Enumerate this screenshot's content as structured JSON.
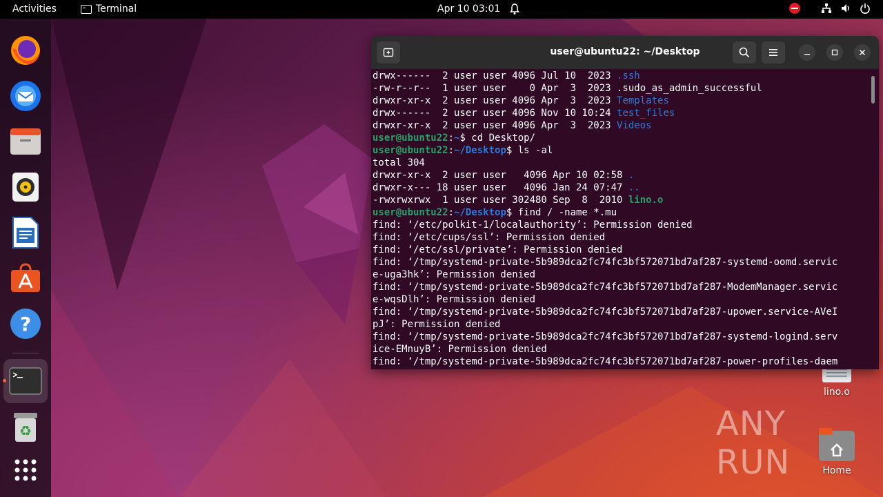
{
  "topbar": {
    "activities": "Activities",
    "app_name": "Terminal",
    "clock": "Apr 10  03:01"
  },
  "dock": {
    "items": [
      {
        "name": "firefox",
        "icon": "firefox-icon"
      },
      {
        "name": "thunderbird",
        "icon": "thunderbird-icon"
      },
      {
        "name": "files",
        "icon": "files-icon"
      },
      {
        "name": "rhythmbox",
        "icon": "rhythmbox-icon"
      },
      {
        "name": "libreoffice-writer",
        "icon": "writer-icon"
      },
      {
        "name": "ubuntu-software",
        "icon": "software-icon"
      },
      {
        "name": "help",
        "icon": "help-icon"
      },
      {
        "name": "terminal",
        "icon": "terminal-icon",
        "running": true
      },
      {
        "name": "trash",
        "icon": "trash-icon"
      },
      {
        "name": "show-apps",
        "icon": "app-grid-icon"
      }
    ]
  },
  "desktop": {
    "icons": [
      {
        "label": "lino.o"
      },
      {
        "label": "Home"
      }
    ],
    "watermark": "ANY RUN"
  },
  "terminal": {
    "title": "user@ubuntu22: ~/Desktop",
    "lines": [
      [
        {
          "t": "drwx------  2 user user 4096 Jul 10  2023 ",
          "c": ""
        },
        {
          "t": ".ssh",
          "c": "dir"
        }
      ],
      [
        {
          "t": "-rw-r--r--  1 user user    0 Apr  3  2023 .sudo_as_admin_successful",
          "c": ""
        }
      ],
      [
        {
          "t": "drwxr-xr-x  2 user user 4096 Apr  3  2023 ",
          "c": ""
        },
        {
          "t": "Templates",
          "c": "dir"
        }
      ],
      [
        {
          "t": "drwx------  2 user user 4096 Nov 10 10:24 ",
          "c": ""
        },
        {
          "t": "test_files",
          "c": "dir"
        }
      ],
      [
        {
          "t": "drwxr-xr-x  2 user user 4096 Apr  3  2023 ",
          "c": ""
        },
        {
          "t": "Videos",
          "c": "dir"
        }
      ],
      [
        {
          "t": "user@ubuntu22",
          "c": "prompt-user"
        },
        {
          "t": ":",
          "c": ""
        },
        {
          "t": "~",
          "c": "prompt-path"
        },
        {
          "t": "$ cd Desktop/",
          "c": ""
        }
      ],
      [
        {
          "t": "user@ubuntu22",
          "c": "prompt-user"
        },
        {
          "t": ":",
          "c": ""
        },
        {
          "t": "~/Desktop",
          "c": "prompt-path"
        },
        {
          "t": "$ ls -al",
          "c": ""
        }
      ],
      [
        {
          "t": "total 304",
          "c": ""
        }
      ],
      [
        {
          "t": "drwxr-xr-x  2 user user   4096 Apr 10 02:58 ",
          "c": ""
        },
        {
          "t": ".",
          "c": "dir"
        }
      ],
      [
        {
          "t": "drwxr-x--- 18 user user   4096 Jan 24 07:47 ",
          "c": ""
        },
        {
          "t": "..",
          "c": "dir"
        }
      ],
      [
        {
          "t": "-rwxrwxrwx  1 user user 302480 Sep  8  2010 ",
          "c": ""
        },
        {
          "t": "lino.o",
          "c": "exe"
        }
      ],
      [
        {
          "t": "user@ubuntu22",
          "c": "prompt-user"
        },
        {
          "t": ":",
          "c": ""
        },
        {
          "t": "~/Desktop",
          "c": "prompt-path"
        },
        {
          "t": "$ find / -name *.mu",
          "c": ""
        }
      ],
      [
        {
          "t": "find: ‘/etc/polkit-1/localauthority’: Permission denied",
          "c": ""
        }
      ],
      [
        {
          "t": "find: ‘/etc/cups/ssl’: Permission denied",
          "c": ""
        }
      ],
      [
        {
          "t": "find: ‘/etc/ssl/private’: Permission denied",
          "c": ""
        }
      ],
      [
        {
          "t": "find: ‘/tmp/systemd-private-5b989dca2fc74fc3bf572071bd7af287-systemd-oomd.servic",
          "c": ""
        }
      ],
      [
        {
          "t": "e-uga3hk’: Permission denied",
          "c": ""
        }
      ],
      [
        {
          "t": "find: ‘/tmp/systemd-private-5b989dca2fc74fc3bf572071bd7af287-ModemManager.servic",
          "c": ""
        }
      ],
      [
        {
          "t": "e-wqsDlh’: Permission denied",
          "c": ""
        }
      ],
      [
        {
          "t": "find: ‘/tmp/systemd-private-5b989dca2fc74fc3bf572071bd7af287-upower.service-AVeI",
          "c": ""
        }
      ],
      [
        {
          "t": "pJ’: Permission denied",
          "c": ""
        }
      ],
      [
        {
          "t": "find: ‘/tmp/systemd-private-5b989dca2fc74fc3bf572071bd7af287-systemd-logind.serv",
          "c": ""
        }
      ],
      [
        {
          "t": "ice-EMnuyB’: Permission denied",
          "c": ""
        }
      ],
      [
        {
          "t": "find: ‘/tmp/systemd-private-5b989dca2fc74fc3bf572071bd7af287-power-profiles-daem",
          "c": ""
        }
      ]
    ]
  },
  "colors": {
    "terminal_bg": "#300a24",
    "prompt_user": "#26a269",
    "prompt_path": "#2a7bde",
    "accent": "#e95420"
  }
}
